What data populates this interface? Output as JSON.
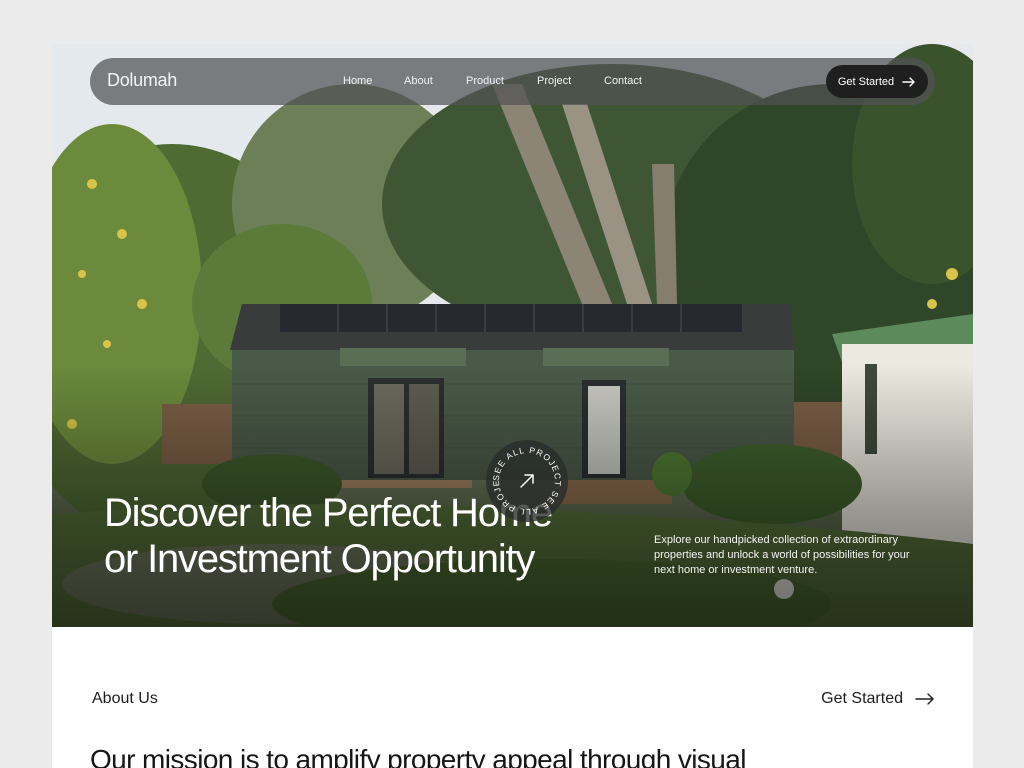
{
  "nav": {
    "logo": "Dolumah",
    "links": [
      "Home",
      "About",
      "Product",
      "Project",
      "Contact"
    ],
    "cta_label": "Get Started"
  },
  "hero": {
    "title_line1": "Discover the Perfect Home",
    "title_line2": "or Investment Opportunity",
    "description": "Explore our handpicked collection of extraordinary properties and unlock a world of possibilities for your next home or investment venture.",
    "badge_text": "SEE ALL PROJECT SEE ALL PROJECT "
  },
  "about": {
    "label": "About Us",
    "cta_label": "Get Started",
    "mission": "Our mission is to amplify property appeal through visual"
  },
  "colors": {
    "page_bg": "#ebebeb",
    "nav_bg": "#505254",
    "cta_bg": "#1f1f1f",
    "house_green": "#4a5a48"
  },
  "icons": {
    "nav_cta": "arrow-right-icon",
    "badge": "arrow-up-right-icon",
    "about_cta": "arrow-right-icon"
  }
}
